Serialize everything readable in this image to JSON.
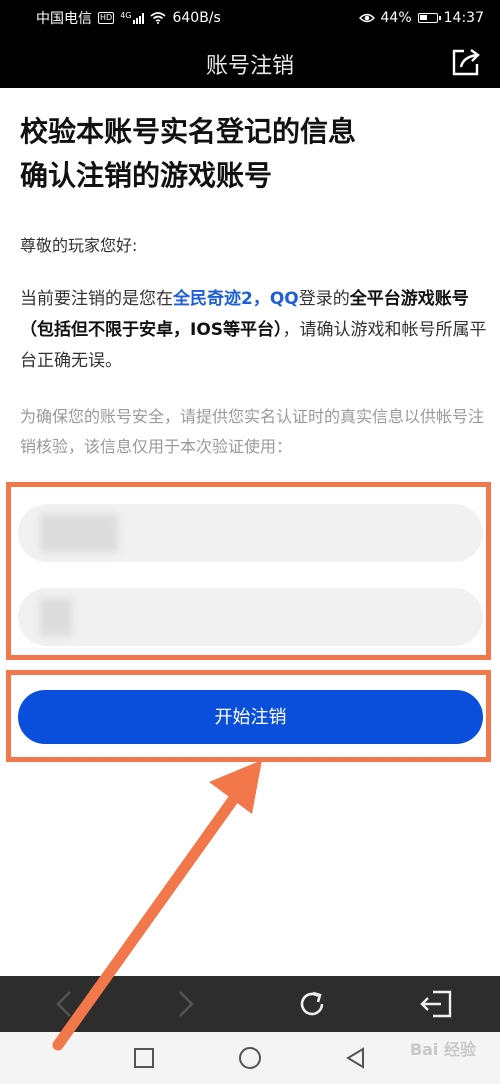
{
  "status_bar": {
    "carrier": "中国电信",
    "network": "4G",
    "speed": "640B/s",
    "battery": "44%",
    "time": "14:37"
  },
  "title_bar": {
    "title": "账号注销"
  },
  "main": {
    "headline_line1": "校验本账号实名登记的信息",
    "headline_line2": "确认注销的游戏账号",
    "greeting": "尊敬的玩家您好:",
    "desc_prefix": "当前要注销的是您在",
    "desc_game": "全民奇迹2，QQ",
    "desc_mid": "登录的",
    "desc_bold": "全平台游戏账号（包括但不限于安卓，IOS等平台）",
    "desc_suffix": "，请确认游戏和帐号所属平台正确无误。",
    "hint": "为确保您的账号安全，请提供您实名认证时的真实信息以供帐号注销核验，该信息仅用于本次验证使用：",
    "start_button": "开始注销"
  },
  "watermark": "Bai 经验",
  "colors": {
    "accent": "#0a4fdc",
    "link": "#1e5fd8",
    "annotation": "#f2774a"
  }
}
